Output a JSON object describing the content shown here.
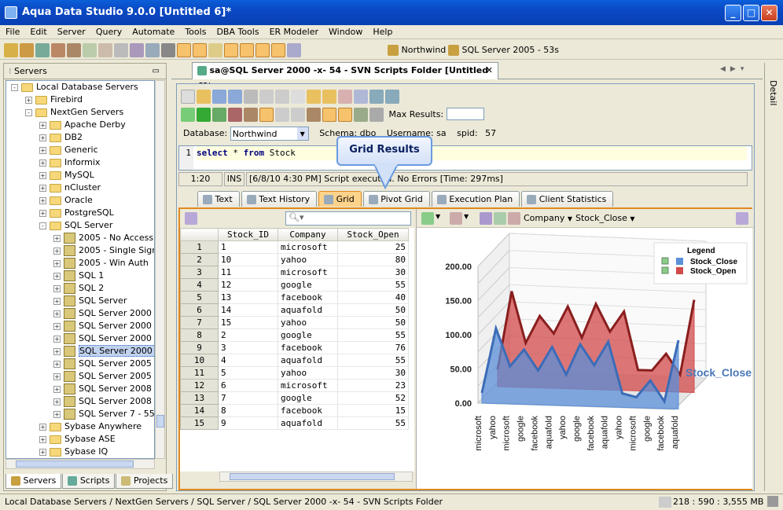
{
  "window": {
    "title": "Aqua Data Studio 9.0.0 [Untitled 6]*"
  },
  "menu": [
    "File",
    "Edit",
    "Server",
    "Query",
    "Automate",
    "Tools",
    "DBA Tools",
    "ER Modeler",
    "Window",
    "Help"
  ],
  "toolbar": {
    "server1": "Northwind",
    "server2": "SQL Server 2005 - 53s"
  },
  "servers_panel": {
    "title": "Servers",
    "tree": [
      {
        "label": "Local Database Servers",
        "level": 0,
        "type": "folder",
        "exp": "-"
      },
      {
        "label": "Firebird",
        "level": 1,
        "type": "folder",
        "exp": "+"
      },
      {
        "label": "NextGen Servers",
        "level": 1,
        "type": "folder",
        "exp": "-"
      },
      {
        "label": "Apache Derby",
        "level": 2,
        "type": "folder",
        "exp": "+"
      },
      {
        "label": "DB2",
        "level": 2,
        "type": "folder",
        "exp": "+"
      },
      {
        "label": "Generic",
        "level": 2,
        "type": "folder",
        "exp": "+"
      },
      {
        "label": "Informix",
        "level": 2,
        "type": "folder",
        "exp": "+"
      },
      {
        "label": "MySQL",
        "level": 2,
        "type": "folder",
        "exp": "+"
      },
      {
        "label": "nCluster",
        "level": 2,
        "type": "folder",
        "exp": "+"
      },
      {
        "label": "Oracle",
        "level": 2,
        "type": "folder",
        "exp": "+"
      },
      {
        "label": "PostgreSQL",
        "level": 2,
        "type": "folder",
        "exp": "+"
      },
      {
        "label": "SQL Server",
        "level": 2,
        "type": "folder",
        "exp": "-"
      },
      {
        "label": "2005 - No Access",
        "level": 3,
        "type": "db",
        "exp": "+"
      },
      {
        "label": "2005 - Single Sign",
        "level": 3,
        "type": "db",
        "exp": "+"
      },
      {
        "label": "2005 - Win Auth",
        "level": 3,
        "type": "db",
        "exp": "+"
      },
      {
        "label": "SQL 1",
        "level": 3,
        "type": "db",
        "exp": "+"
      },
      {
        "label": "SQL 2",
        "level": 3,
        "type": "db",
        "exp": "+"
      },
      {
        "label": "SQL Server",
        "level": 3,
        "type": "db",
        "exp": "+"
      },
      {
        "label": "SQL Server 2000 -",
        "level": 3,
        "type": "db",
        "exp": "+"
      },
      {
        "label": "SQL Server 2000 -",
        "level": 3,
        "type": "db",
        "exp": "+"
      },
      {
        "label": "SQL Server 2000 -",
        "level": 3,
        "type": "db",
        "exp": "+"
      },
      {
        "label": "SQL Server 2000 -",
        "level": 3,
        "type": "db",
        "exp": "+",
        "selected": true
      },
      {
        "label": "SQL Server 2005 -",
        "level": 3,
        "type": "db",
        "exp": "+"
      },
      {
        "label": "SQL Server 2005 -",
        "level": 3,
        "type": "db",
        "exp": "+"
      },
      {
        "label": "SQL Server 2008 -",
        "level": 3,
        "type": "db",
        "exp": "+"
      },
      {
        "label": "SQL Server 2008 -",
        "level": 3,
        "type": "db",
        "exp": "+"
      },
      {
        "label": "SQL Server 7 - 55",
        "level": 3,
        "type": "db",
        "exp": "+"
      },
      {
        "label": "Sybase Anywhere",
        "level": 2,
        "type": "folder",
        "exp": "+"
      },
      {
        "label": "Sybase ASE",
        "level": 2,
        "type": "folder",
        "exp": "+"
      },
      {
        "label": "Sybase IQ",
        "level": 2,
        "type": "folder",
        "exp": "+"
      }
    ],
    "bottom_tabs": [
      "Servers",
      "Scripts",
      "Projects"
    ]
  },
  "doc_tab": {
    "label": "sa@SQL Server 2000 -x- 54 - SVN Scripts Folder [Untitled 6]*"
  },
  "right_panel_label": "Detail",
  "query": {
    "max_results_label": "Max Results:",
    "max_results_value": "",
    "database_label": "Database:",
    "database_value": "Northwind",
    "schema_label": "Schema:",
    "schema_value": "dbo",
    "user_label": "Username:",
    "user_value": "sa",
    "spid_label": "spid:",
    "spid_value": "57",
    "line_no": "1",
    "sql_keyword1": "select",
    "sql_star": "*",
    "sql_keyword2": "from",
    "sql_table": "Stock"
  },
  "editor_status": {
    "pos": "1:20",
    "mode": "INS",
    "message": "[6/8/10 4:30 PM] Script executed. No Errors [Time: 297ms]"
  },
  "callout": "Grid Results",
  "result_tabs": [
    "Text",
    "Text History",
    "Grid",
    "Pivot Grid",
    "Execution Plan",
    "Client Statistics"
  ],
  "grid": {
    "columns": [
      "Stock_ID",
      "Company",
      "Stock_Open"
    ],
    "rows": [
      [
        "1",
        "1",
        "microsoft",
        "25"
      ],
      [
        "2",
        "10",
        "yahoo",
        "80"
      ],
      [
        "3",
        "11",
        "microsoft",
        "30"
      ],
      [
        "4",
        "12",
        "google",
        "55"
      ],
      [
        "5",
        "13",
        "facebook",
        "40"
      ],
      [
        "6",
        "14",
        "aquafold",
        "50"
      ],
      [
        "7",
        "15",
        "yahoo",
        "50"
      ],
      [
        "8",
        "2",
        "google",
        "55"
      ],
      [
        "9",
        "3",
        "facebook",
        "76"
      ],
      [
        "10",
        "4",
        "aquafold",
        "55"
      ],
      [
        "11",
        "5",
        "yahoo",
        "30"
      ],
      [
        "12",
        "6",
        "microsoft",
        "23"
      ],
      [
        "13",
        "7",
        "google",
        "52"
      ],
      [
        "14",
        "8",
        "facebook",
        "15"
      ],
      [
        "15",
        "9",
        "aquafold",
        "55"
      ]
    ]
  },
  "chart_toolbar": {
    "x_field": "Company",
    "y_field": "Stock_Close"
  },
  "chart_data": {
    "type": "area",
    "title": "",
    "axis_label_right": "Stock_Close",
    "categories": [
      "microsoft",
      "yahoo",
      "microsoft",
      "google",
      "facebook",
      "aquafold",
      "yahoo",
      "google",
      "facebook",
      "aquafold",
      "yahoo",
      "microsoft",
      "google",
      "facebook",
      "aquafold"
    ],
    "ylim": [
      0,
      200
    ],
    "yticks": [
      "200.00",
      "150.00",
      "100.00",
      "50.00",
      "0.00"
    ],
    "legend_title": "Legend",
    "series": [
      {
        "name": "Stock_Close",
        "color": "#5b8fd8",
        "values": [
          15,
          110,
          55,
          80,
          50,
          85,
          45,
          90,
          60,
          95,
          20,
          15,
          40,
          10,
          100
        ]
      },
      {
        "name": "Stock_Open",
        "color": "#d24a4a",
        "values": [
          25,
          140,
          65,
          105,
          80,
          120,
          75,
          125,
          85,
          115,
          30,
          30,
          55,
          25,
          135
        ]
      }
    ]
  },
  "status_bar": {
    "path": "Local Database Servers / NextGen Servers / SQL Server / SQL Server 2000 -x- 54 - SVN Scripts Folder",
    "memory": "218 : 590 : 3,555 MB"
  }
}
